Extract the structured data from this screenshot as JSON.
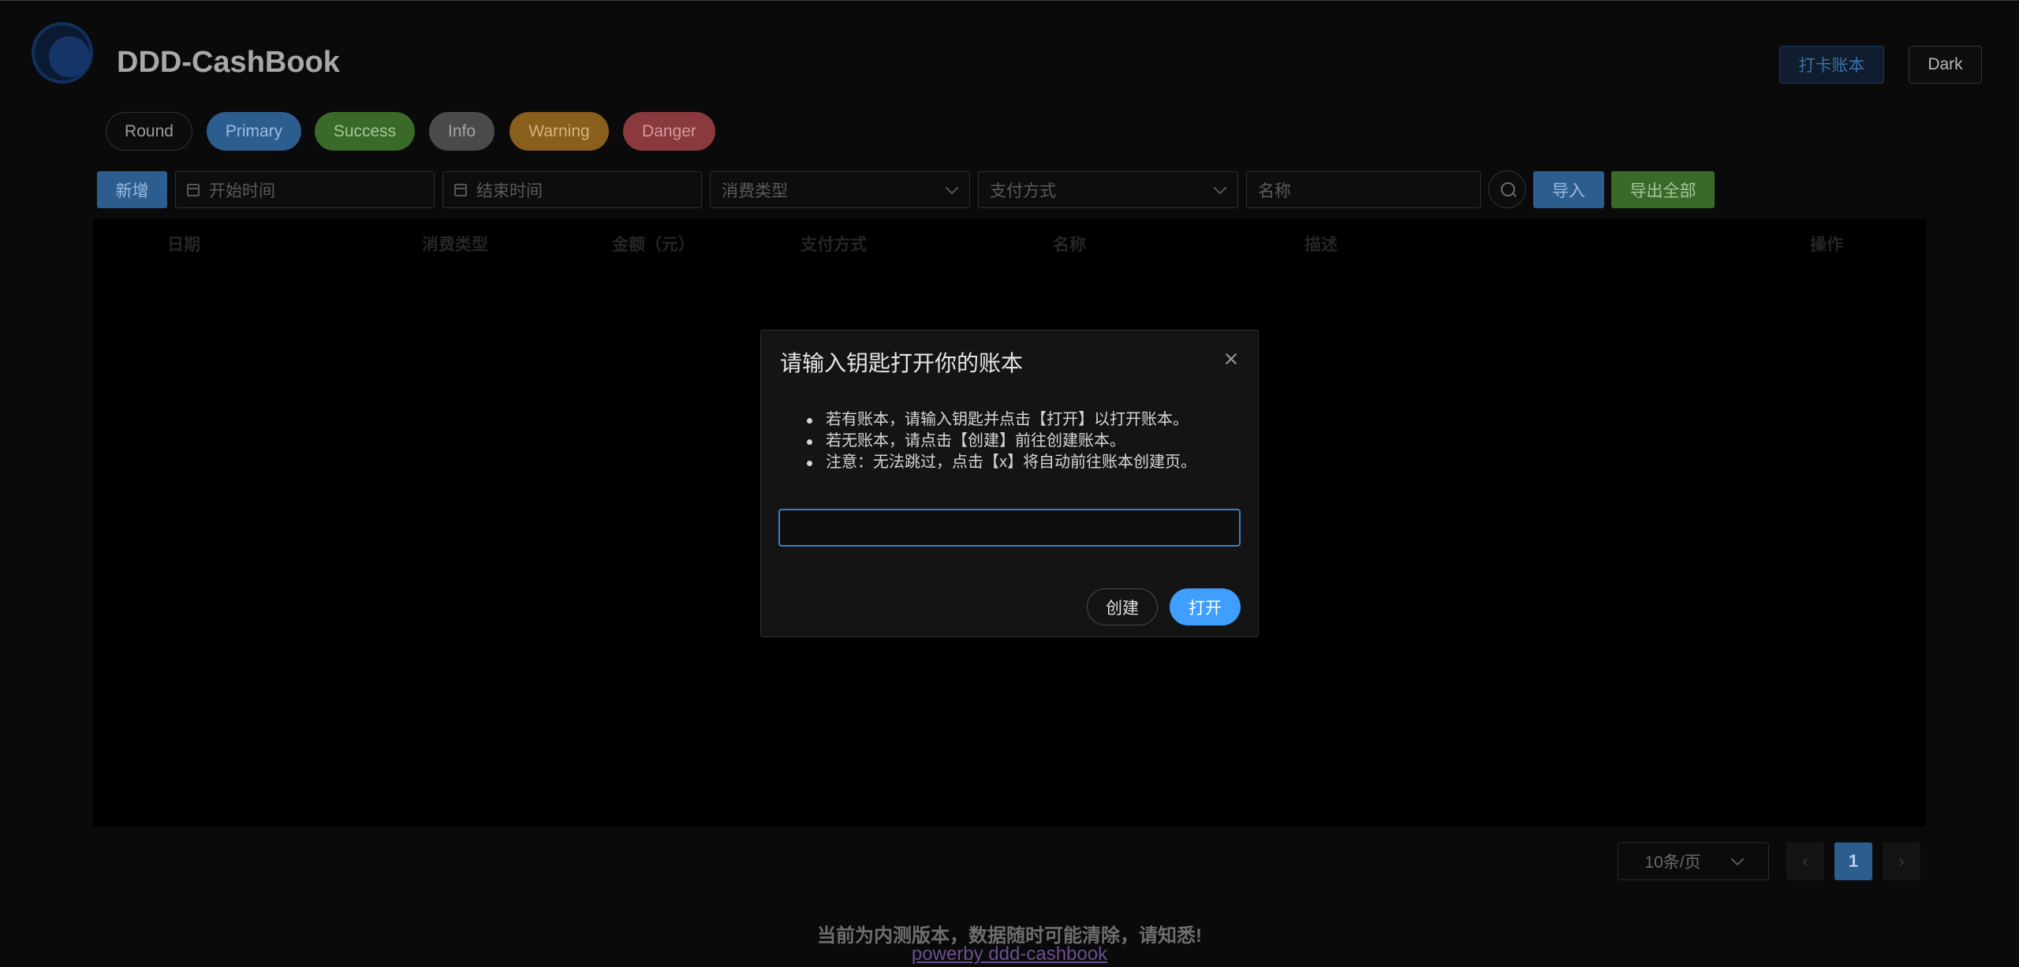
{
  "header": {
    "app_title": "DDD-CashBook",
    "punch_button": "打卡账本",
    "theme_button": "Dark"
  },
  "pills": [
    "Round",
    "Primary",
    "Success",
    "Info",
    "Warning",
    "Danger"
  ],
  "toolbar": {
    "add_button": "新增",
    "start_time_placeholder": "开始时间",
    "end_time_placeholder": "结束时间",
    "consume_type_placeholder": "消费类型",
    "pay_method_placeholder": "支付方式",
    "name_placeholder": "名称",
    "import_button": "导入",
    "export_button": "导出全部"
  },
  "table": {
    "columns": [
      "日期",
      "消费类型",
      "金额（元）",
      "支付方式",
      "名称",
      "描述",
      "操作"
    ],
    "rows": []
  },
  "pagination": {
    "page_size": "10条/页",
    "current_page": "1",
    "prev_icon": "chevron-left-icon",
    "next_icon": "chevron-right-icon"
  },
  "footer": {
    "notice": "当前为内测版本，数据随时可能清除，请知悉!",
    "powerby": "powerby ddd-cashbook"
  },
  "modal": {
    "title": "请输入钥匙打开你的账本",
    "lines": [
      "若有账本，请输入钥匙并点击【打开】以打开账本。",
      "若无账本，请点击【创建】前往创建账本。",
      "注意：无法跳过，点击【x】将自动前往账本创建页。"
    ],
    "key_input_value": "",
    "create_button": "创建",
    "open_button": "打开"
  },
  "colors": {
    "primary": "#409eff",
    "success": "#67c23a",
    "warning": "#e6a23c",
    "danger": "#f56c6c",
    "info": "#909399"
  }
}
